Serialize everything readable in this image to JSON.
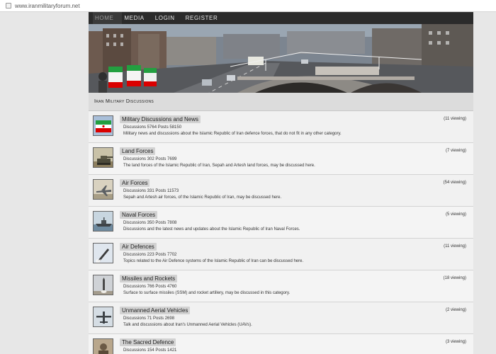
{
  "browser": {
    "url": "www.iranmilitaryforum.net"
  },
  "nav": [
    "HOME",
    "MEDIA",
    "LOGIN",
    "REGISTER"
  ],
  "section": {
    "title": "Iran Military Discussions"
  },
  "forums": [
    {
      "title": "Military Discussions and News",
      "stats": "Discussions 5764 Posts 58150",
      "desc": "Military news and discussions about the Islamic Republic of Iran defence forces, that do not fit in any other category.",
      "viewing": "(11 viewing)",
      "icon": "iran-flag-icon"
    },
    {
      "title": "Land Forces",
      "stats": "Discussions 302 Posts 7699",
      "desc": "The land forces of the Islamic Republic of Iran, Sepah and Artesh land forces, may be discussed here.",
      "viewing": "(7 viewing)",
      "icon": "tank-icon"
    },
    {
      "title": "Air Forces",
      "stats": "Discussions 331 Posts 11573",
      "desc": "Sepah and Artesh air forces, of the Islamic Republic of Iran, may be discussed here.",
      "viewing": "(54 viewing)",
      "icon": "fighter-jet-icon"
    },
    {
      "title": "Naval Forces",
      "stats": "Discussions 350 Posts 7808",
      "desc": "Discussions and the latest news and updates about the Islamic Republic of Iran Naval Forces.",
      "viewing": "(5 viewing)",
      "icon": "warship-icon"
    },
    {
      "title": "Air Defences",
      "stats": "Discussions 223 Posts 7702",
      "desc": "Topics related to the Air Defence systems of the Islamic Republic of Iran can be discussed here.",
      "viewing": "(11 viewing)",
      "icon": "missile-launch-icon"
    },
    {
      "title": "Missiles and Rockets",
      "stats": "Discussions 766 Posts 4760",
      "desc": "Surface to surface missiles (SSM) and rocket artillery, may be discussed in this category.",
      "viewing": "(18 viewing)",
      "icon": "rocket-icon"
    },
    {
      "title": "Unmanned Aerial Vehicles",
      "stats": "Discussions 71 Posts 2698",
      "desc": "Talk and discussions about Iran's Unmanned Aerial Vehicles (UAVs).",
      "viewing": "(2 viewing)",
      "icon": "drone-icon"
    },
    {
      "title": "The Sacred Defence",
      "stats": "Discussions 154 Posts 1421",
      "desc": "",
      "viewing": "(3 viewing)",
      "icon": "soldier-icon"
    }
  ]
}
